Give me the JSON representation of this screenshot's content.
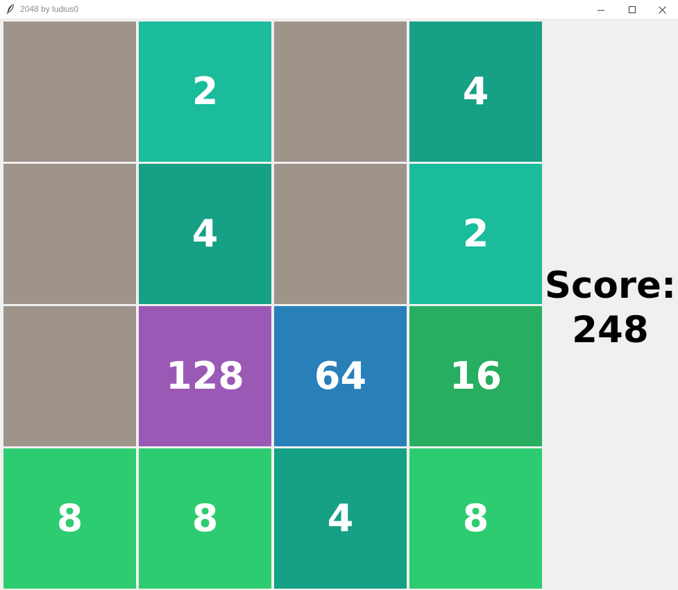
{
  "window": {
    "title": "2048 by ludius0",
    "app_icon": "feather-icon",
    "controls": [
      "minimize-icon",
      "maximize-icon",
      "close-icon"
    ]
  },
  "board": {
    "rows": [
      [
        {
          "value": "",
          "color": "#9e948a"
        },
        {
          "value": "2",
          "color": "#1abc9c"
        },
        {
          "value": "",
          "color": "#9e948a"
        },
        {
          "value": "4",
          "color": "#16a085"
        }
      ],
      [
        {
          "value": "",
          "color": "#9e948a"
        },
        {
          "value": "4",
          "color": "#16a085"
        },
        {
          "value": "",
          "color": "#9e948a"
        },
        {
          "value": "2",
          "color": "#1abc9c"
        }
      ],
      [
        {
          "value": "",
          "color": "#9e948a"
        },
        {
          "value": "128",
          "color": "#9b59b6"
        },
        {
          "value": "64",
          "color": "#2980b9"
        },
        {
          "value": "16",
          "color": "#27ae60"
        }
      ],
      [
        {
          "value": "8",
          "color": "#2ecc71"
        },
        {
          "value": "8",
          "color": "#2ecc71"
        },
        {
          "value": "4",
          "color": "#16a085"
        },
        {
          "value": "8",
          "color": "#2ecc71"
        }
      ]
    ]
  },
  "score": {
    "label": "Score:",
    "value": "248"
  }
}
